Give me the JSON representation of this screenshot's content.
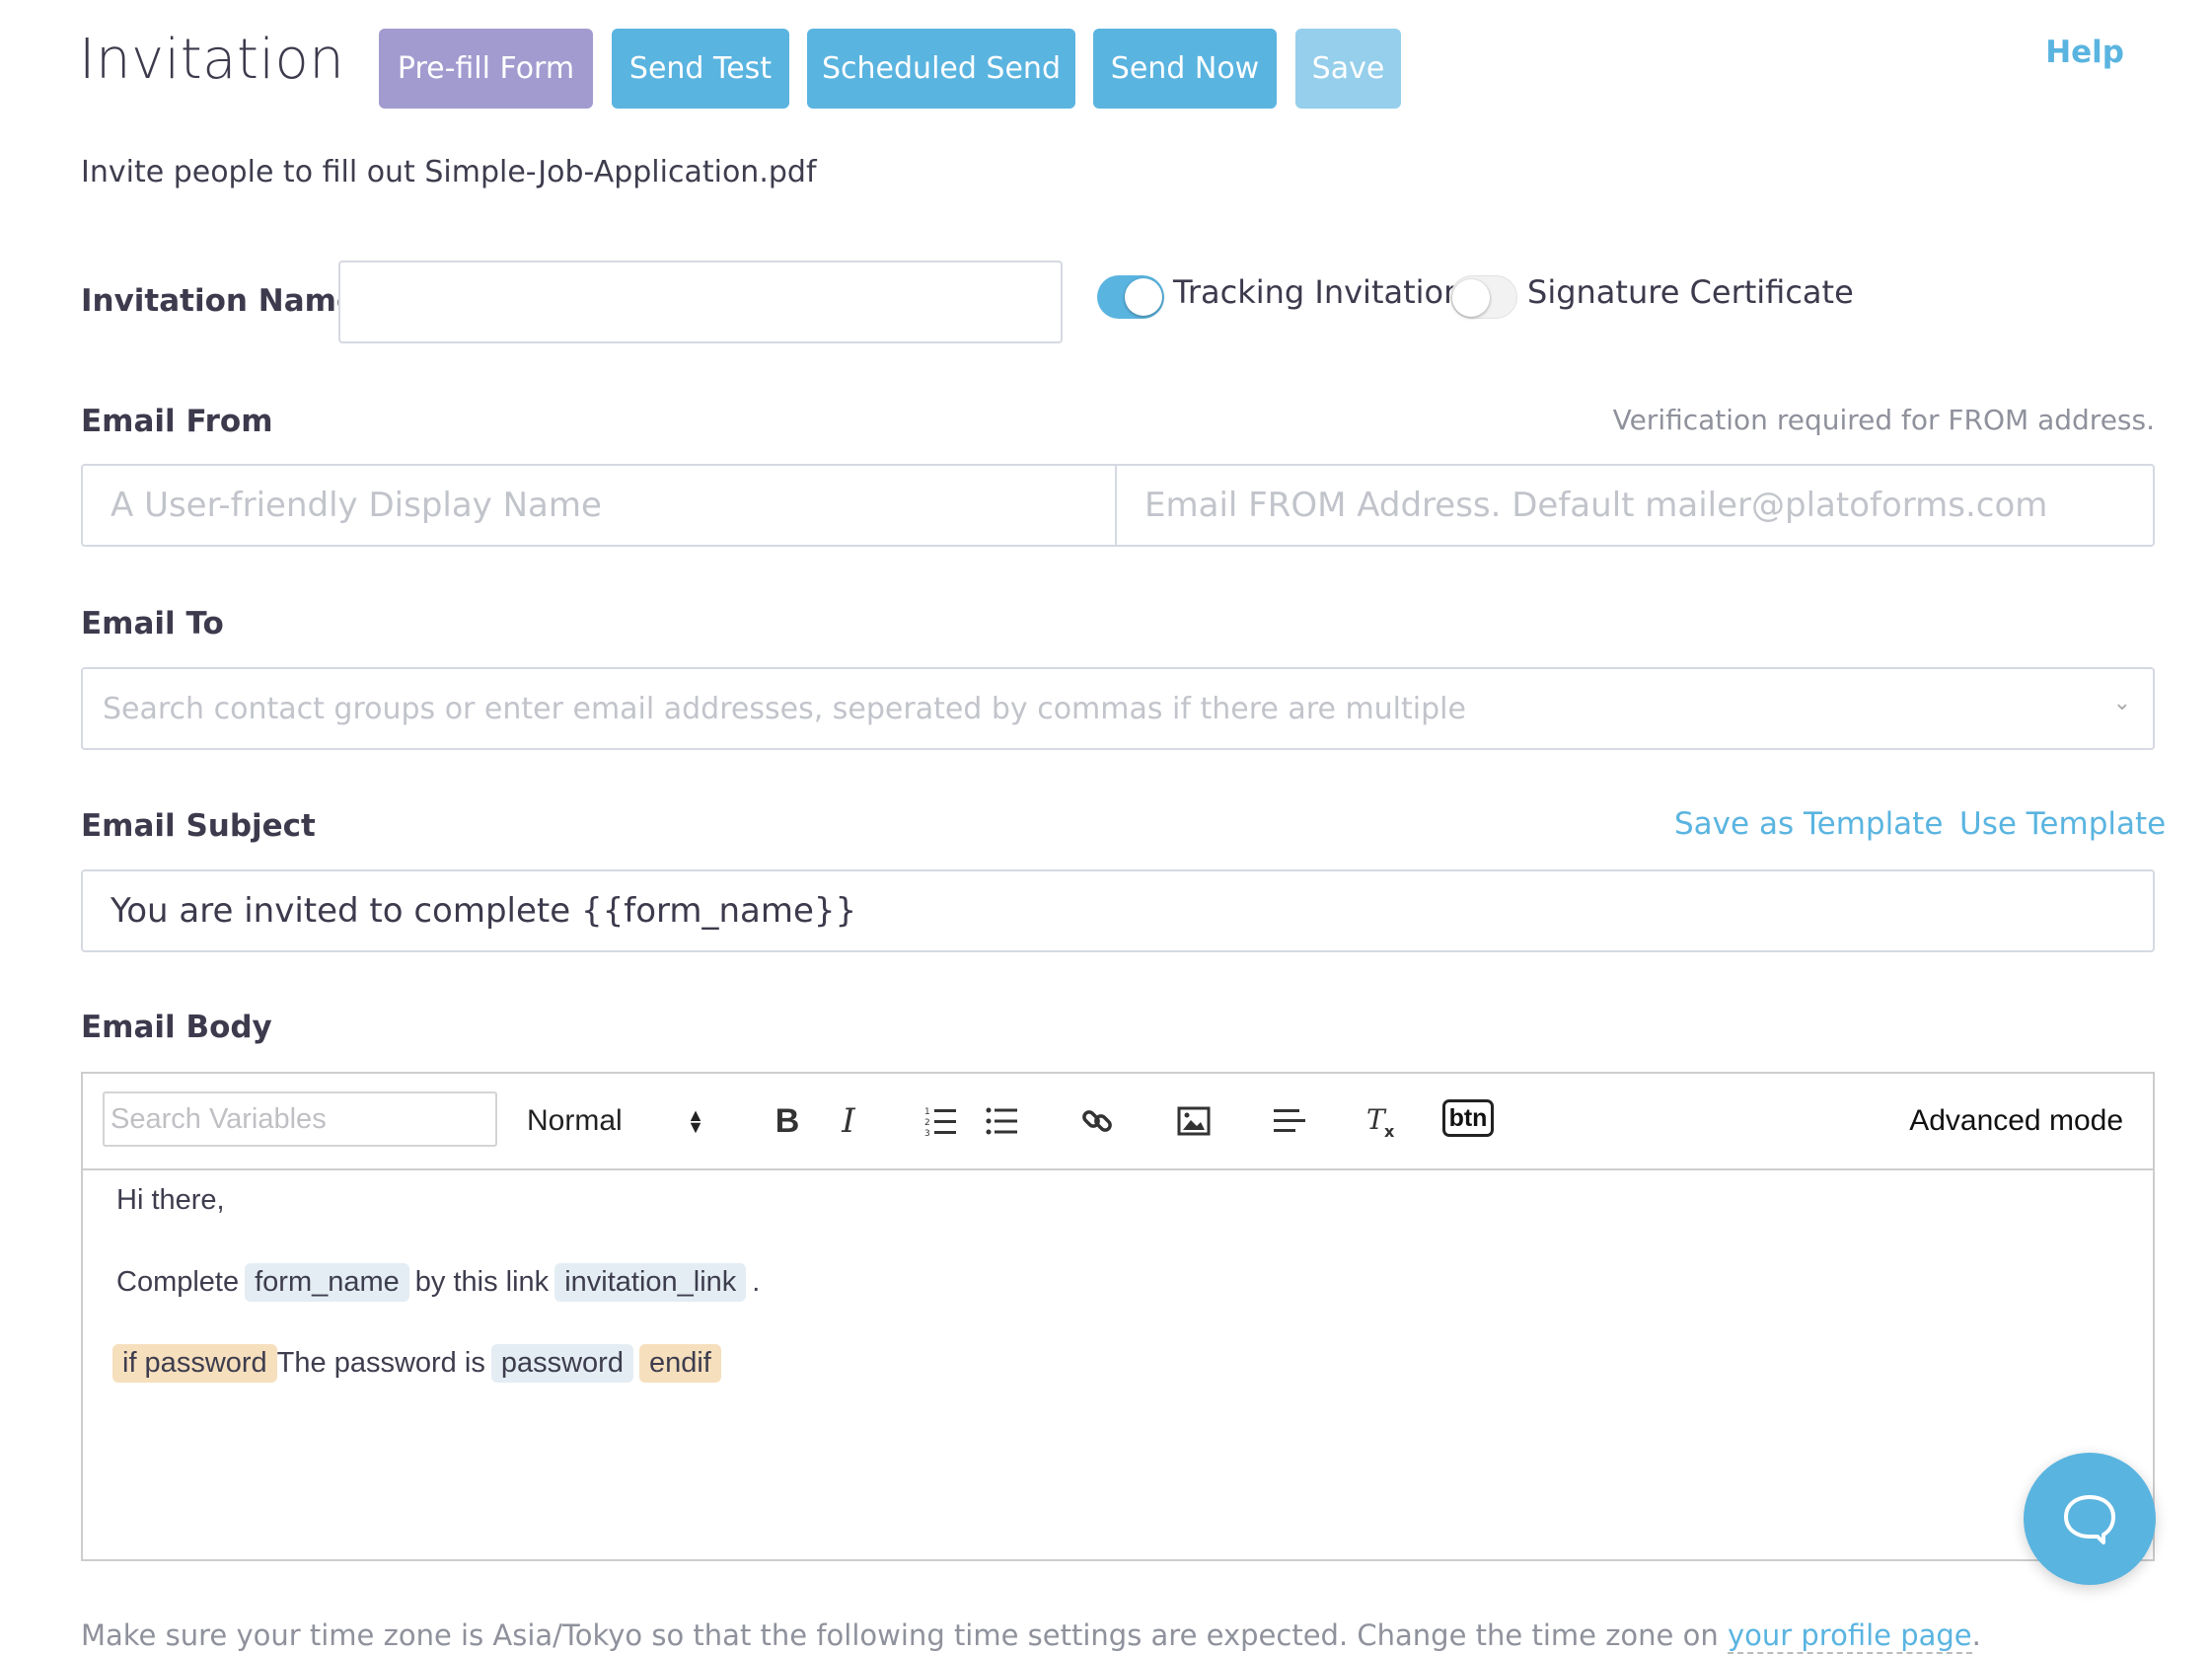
{
  "header": {
    "title": "Invitation",
    "buttons": {
      "prefill": "Pre-fill Form",
      "send_test": "Send Test",
      "scheduled_send": "Scheduled Send",
      "send_now": "Send Now",
      "save": "Save"
    },
    "help": "Help",
    "subtitle": "Invite people to fill out Simple-Job-Application.pdf"
  },
  "invitation_name": {
    "label": "Invitation Name",
    "value": ""
  },
  "toggles": {
    "tracking": {
      "label": "Tracking Invitation",
      "on": true
    },
    "signature": {
      "label": "Signature Certificate",
      "on": false
    }
  },
  "email_from": {
    "label": "Email From",
    "hint": "Verification required for FROM address.",
    "display_name_placeholder": "A User-friendly Display Name",
    "address_placeholder": "Email FROM Address. Default mailer@platoforms.com"
  },
  "email_to": {
    "label": "Email To",
    "placeholder": "Search contact groups or enter email addresses, seperated by commas if there are multiple"
  },
  "email_subject": {
    "label": "Email Subject",
    "save_template": "Save as Template",
    "use_template": "Use Template",
    "value": "You are invited to complete {{form_name}}"
  },
  "email_body": {
    "label": "Email Body",
    "toolbar": {
      "search_placeholder": "Search Variables",
      "format": "Normal",
      "btn_label": "btn",
      "advanced_mode": "Advanced mode"
    },
    "content": {
      "greeting": "Hi there,",
      "line2": {
        "t1": "Complete",
        "var1": "form_name",
        "t2": "by this link",
        "var2": "invitation_link",
        "t3": "."
      },
      "line3": {
        "cond1": "if password",
        "t1": "The password is",
        "var1": "password",
        "cond2": "endif"
      }
    }
  },
  "footer": {
    "text": "Make sure your time zone is Asia/Tokyo so that the following time settings are expected. Change the time zone on ",
    "link": "your profile page",
    "end": "."
  },
  "colors": {
    "accent": "#5ab4e0",
    "prefill": "#a29bcf",
    "variable_chip": "#e4edf3",
    "condition_chip": "#f6dfbd"
  }
}
